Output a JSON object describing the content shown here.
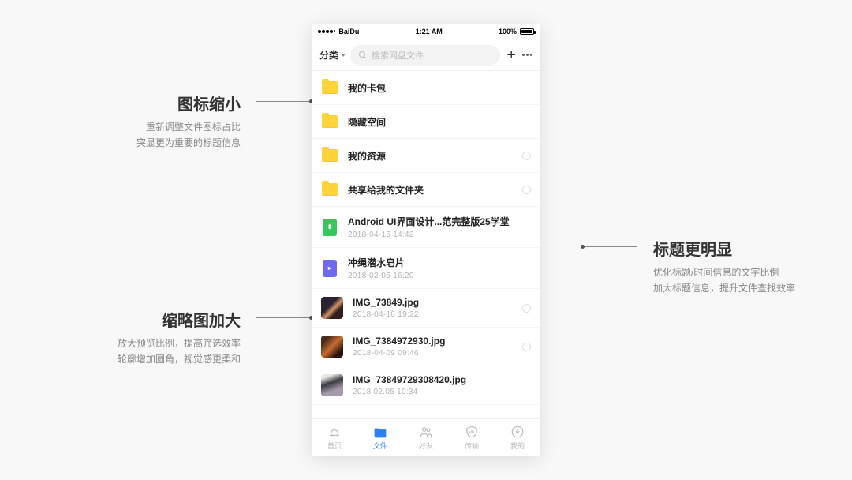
{
  "callouts": {
    "a": {
      "title": "图标缩小",
      "desc": "重新调整文件图标占比\n突显更为重要的标题信息"
    },
    "b": {
      "title": "缩略图加大",
      "desc": "放大预览比例，提高筛选效率\n轮廓增加圆角，视觉感更柔和"
    },
    "c": {
      "title": "标题更明显",
      "desc": "优化标题/时间信息的文字比例\n加大标题信息，提升文件查找效率"
    }
  },
  "statusbar": {
    "carrier": "BaiDu",
    "time": "1:21 AM",
    "battery": "100%"
  },
  "topbar": {
    "category": "分类",
    "search_placeholder": "搜索网盘文件"
  },
  "files": [
    {
      "type": "folder",
      "name": "我的卡包"
    },
    {
      "type": "folder",
      "name": "隐藏空间"
    },
    {
      "type": "folder",
      "name": "我的资源",
      "selectable": true
    },
    {
      "type": "folder",
      "name": "共享给我的文件夹",
      "selectable": true
    },
    {
      "type": "doc",
      "doc_kind": "green",
      "name": "Android UI界面设计...范完整版25学堂",
      "date": "2018-04-15   14:42"
    },
    {
      "type": "doc",
      "doc_kind": "purple",
      "name": "冲绳潜水皂片",
      "date": "2018-02-05   16:20"
    },
    {
      "type": "image",
      "img": "ph1",
      "name": "IMG_73849.jpg",
      "date": "2018-04-10   19:22",
      "selectable": true
    },
    {
      "type": "image",
      "img": "ph2",
      "name": "IMG_7384972930.jpg",
      "date": "2018-04-09   09:46",
      "selectable": true
    },
    {
      "type": "image",
      "img": "ph3",
      "name": "IMG_73849729308420.jpg",
      "date": "2018.02.05   10:34"
    }
  ],
  "tabs": [
    {
      "label": "首页"
    },
    {
      "label": "文件",
      "active": true
    },
    {
      "label": "好友"
    },
    {
      "label": "传输"
    },
    {
      "label": "我的"
    }
  ]
}
